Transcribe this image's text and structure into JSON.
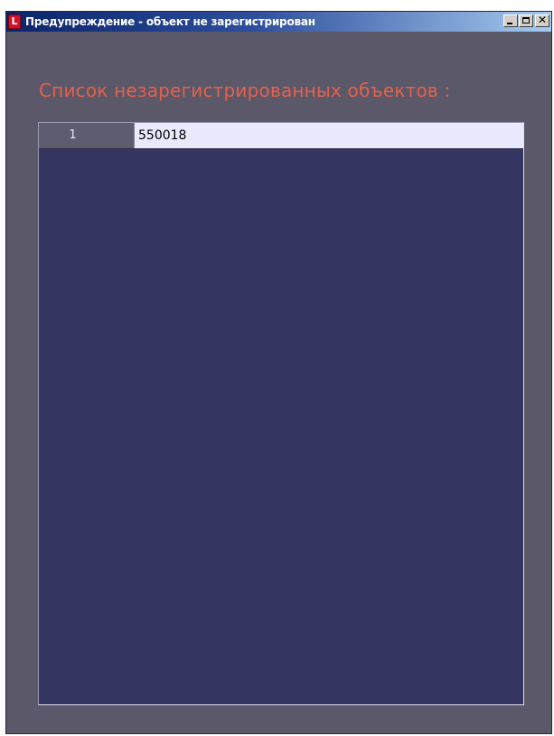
{
  "window": {
    "title": "Предупреждение - объект не зарегистрирован",
    "icon": "app-logo-icon",
    "icon_letter": "L",
    "caption_buttons": {
      "minimize": "minimize-icon",
      "maximize": "maximize-icon",
      "close": "close-icon",
      "close_glyph": "✕"
    }
  },
  "list": {
    "heading": "Список незарегистрированных объектов :",
    "rows": [
      {
        "index": "1",
        "value": "550018"
      }
    ]
  },
  "colors": {
    "heading": "#e8604a",
    "window_bg": "#5a5869",
    "grid_bg": "#353562",
    "cell_bg": "#e9e8fc"
  }
}
